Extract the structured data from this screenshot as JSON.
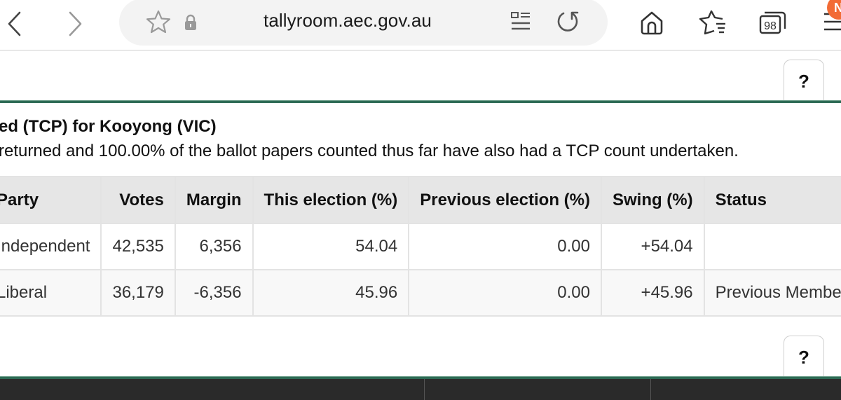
{
  "browser": {
    "url": "tallyroom.aec.gov.au",
    "tab_count": "98",
    "menu_badge": "N",
    "icons": {
      "back": "chevron-left-icon",
      "forward": "chevron-right-icon",
      "bookmark": "star-icon",
      "lock": "lock-icon",
      "reader": "reader-mode-icon",
      "reload": "reload-icon",
      "home": "home-icon",
      "bookmarks": "bookmarks-icon",
      "tabs": "tabs-icon",
      "menu": "menu-icon"
    }
  },
  "page": {
    "help_label": "?",
    "heading": "ed (TCP) for Kooyong (VIC)",
    "subtext": "returned and 100.00% of the ballot papers counted thus far have also had a TCP count undertaken.",
    "table": {
      "headers": [
        "Party",
        "Votes",
        "Margin",
        "This election (%)",
        "Previous election (%)",
        "Swing (%)",
        "Status"
      ],
      "rows": [
        [
          "Independent",
          "42,535",
          "6,356",
          "54.04",
          "0.00",
          "+54.04",
          ""
        ],
        [
          "Liberal",
          "36,179",
          "-6,356",
          "45.96",
          "0.00",
          "+45.96",
          "Previous Member"
        ]
      ]
    }
  },
  "colors": {
    "accent_green": "#2e6b55",
    "badge_orange": "#f26b35",
    "header_bg": "#e6e6e6",
    "footer_bg": "#2a2a2a"
  }
}
